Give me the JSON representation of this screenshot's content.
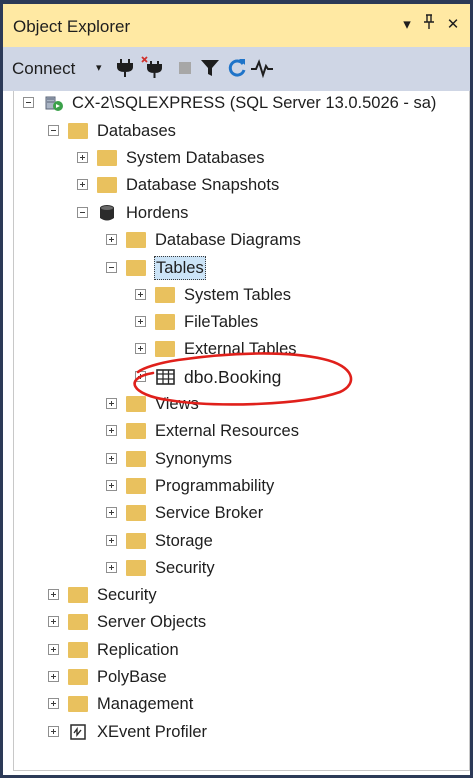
{
  "panel": {
    "title": "Object Explorer",
    "dropdown_glyph": "▾",
    "pin_glyph": "⊥",
    "close_glyph": "✕"
  },
  "toolbar": {
    "connect_label": "Connect",
    "connect_caret": "▾",
    "icons": [
      "connect-plug-icon",
      "disconnect-plug-icon",
      "stop-icon",
      "filter-icon",
      "refresh-icon",
      "activity-monitor-icon"
    ]
  },
  "tree": {
    "server": "CX-2\\SQLEXPRESS (SQL Server 13.0.5026 - sa)",
    "databases": "Databases",
    "system_databases": "System Databases",
    "database_snapshots": "Database Snapshots",
    "hordens": "Hordens",
    "database_diagrams": "Database Diagrams",
    "tables": "Tables",
    "system_tables": "System Tables",
    "file_tables": "FileTables",
    "external_tables": "External Tables",
    "dbo_booking": "dbo.Booking",
    "views": "Views",
    "external_resources": "External Resources",
    "synonyms": "Synonyms",
    "programmability": "Programmability",
    "service_broker": "Service Broker",
    "storage": "Storage",
    "db_security": "Security",
    "security": "Security",
    "server_objects": "Server Objects",
    "replication": "Replication",
    "polybase": "PolyBase",
    "management": "Management",
    "xevent_profiler": "XEvent Profiler"
  },
  "colors": {
    "title_bar": "#ffe9a3",
    "toolbar": "#cfd6e5",
    "folder": "#e9c15e",
    "annotation": "#e0201b",
    "selection": "#cce4f7"
  }
}
